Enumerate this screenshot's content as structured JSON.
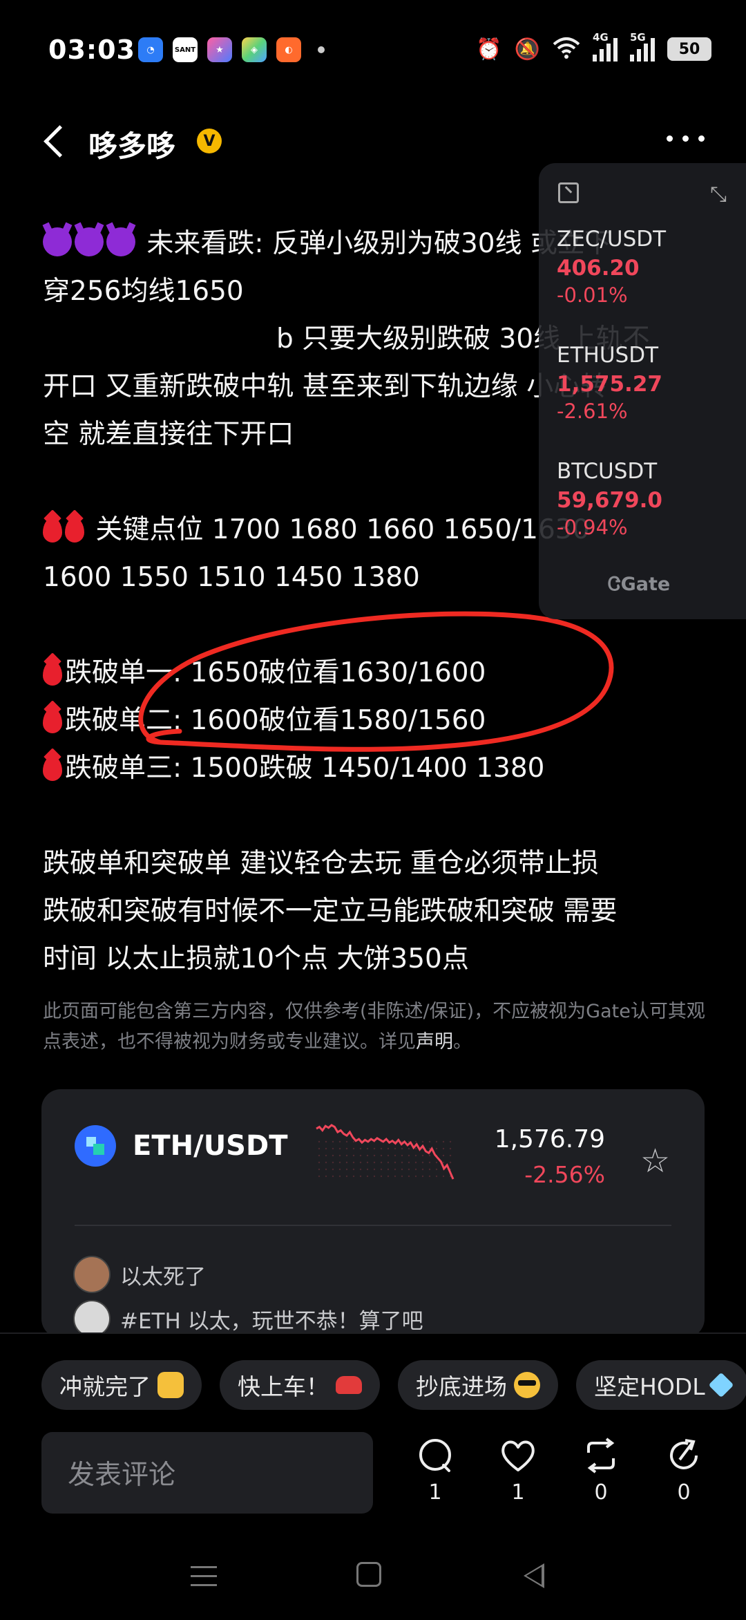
{
  "status_bar": {
    "time": "03:03",
    "network1": "4G",
    "network2": "5G",
    "battery": "50",
    "icons": [
      "alarm-icon",
      "mute-icon",
      "wifi-icon",
      "signal-icon",
      "battery-icon"
    ]
  },
  "header": {
    "title": "哆多哆",
    "badge": "V"
  },
  "post": {
    "line1": "未来看跌: 反弹小级别为破30线 或立下",
    "line2": "穿256均线1650",
    "line3": "b 只要大级别跌破 30线 上轨不",
    "line4": "开口 又重新跌破中轨 甚至来到下轨边缘 小心转",
    "line5": "空 就差直接往下开口",
    "line6": "关键点位  1700   1680 1660 1650/1630",
    "line7": "1600   1550 1510  1450 1380",
    "line8": "跌破单一: 1650破位看1630/1600",
    "line9": "跌破单二:  1600破位看1580/1560",
    "line10": "跌破单三: 1500跌破 1450/1400 1380",
    "line11": "跌破单和突破单 建议轻仓去玩 重仓必须带止损",
    "line12": "跌破和突破有时候不一定立马能跌破和突破 需要",
    "line13": "时间  以太止损就10个点  大饼350点"
  },
  "disclaimer": {
    "text": "此页面可能包含第三方内容，仅供参考(非陈述/保证)，不应被视为Gate认可其观点表述，也不得被视为财务或专业建议。详见",
    "link": "声明",
    "end": "。"
  },
  "widget": {
    "items": [
      {
        "pair": "ZEC/USDT",
        "price": "406.20",
        "change": "-0.01%"
      },
      {
        "pair": "ETHUSDT",
        "price": "1,575.27",
        "change": "-2.61%"
      },
      {
        "pair": "BTCUSDT",
        "price": "59,679.0",
        "change": "-0.94%"
      }
    ],
    "brand": "Gate"
  },
  "card": {
    "pair": "ETH/USDT",
    "price": "1,576.79",
    "change": "-2.56%",
    "sparkline": [
      68,
      70,
      66,
      71,
      69,
      72,
      70,
      64,
      66,
      62,
      60,
      64,
      58,
      54,
      56,
      52,
      55,
      53,
      56,
      54,
      57,
      55,
      53,
      56,
      52,
      54,
      51,
      55,
      50,
      53,
      49,
      52,
      46,
      50,
      44,
      48,
      42,
      40,
      45,
      38,
      34,
      30,
      22,
      26,
      18,
      10
    ],
    "comments": [
      {
        "text": "以太死了"
      },
      {
        "text": "#ETH 以太，玩世不恭！算了吧"
      }
    ]
  },
  "chips": [
    "冲就完了",
    "快上车！",
    "抄底进场",
    "坚定HODL"
  ],
  "comment_placeholder": "发表评论",
  "actions": {
    "comment": "1",
    "like": "1",
    "repost": "0",
    "share": "0"
  }
}
